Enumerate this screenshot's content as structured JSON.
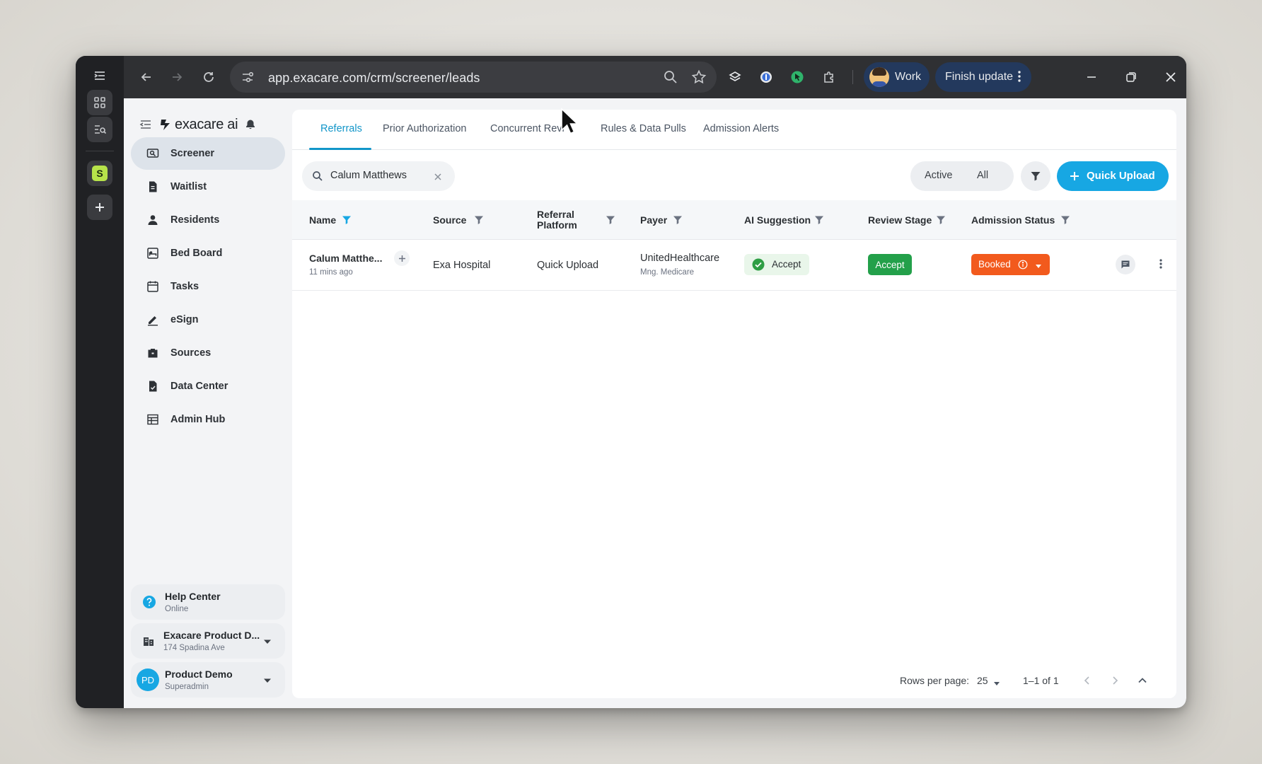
{
  "browser": {
    "url": "app.exacare.com/crm/screener/leads",
    "profile_label": "Work",
    "update_label": "Finish update"
  },
  "sidebar": {
    "brand": "exacare ai",
    "items": [
      {
        "label": "Screener",
        "icon": "screener-icon",
        "active": true
      },
      {
        "label": "Waitlist",
        "icon": "waitlist-icon"
      },
      {
        "label": "Residents",
        "icon": "person-icon"
      },
      {
        "label": "Bed Board",
        "icon": "bed-board-icon"
      },
      {
        "label": "Tasks",
        "icon": "calendar-icon"
      },
      {
        "label": "eSign",
        "icon": "pen-icon"
      },
      {
        "label": "Sources",
        "icon": "briefcase-icon"
      },
      {
        "label": "Data Center",
        "icon": "document-icon"
      },
      {
        "label": "Admin Hub",
        "icon": "table-icon"
      }
    ],
    "help": {
      "title": "Help Center",
      "status": "Online"
    },
    "facility": {
      "name": "Exacare Product D...",
      "address": "174 Spadina Ave"
    },
    "user": {
      "initials": "PD",
      "name": "Product Demo",
      "role": "Superadmin"
    }
  },
  "tabs": [
    "Referrals",
    "Prior Authorization",
    "Concurrent Revi",
    "Rules & Data Pulls",
    "Admission Alerts"
  ],
  "search": {
    "value": "Calum Matthews"
  },
  "toggle": {
    "active": "Active",
    "all": "All"
  },
  "quick_upload": "Quick Upload",
  "table": {
    "headers": {
      "name": "Name",
      "source": "Source",
      "referral_platform_1": "Referral",
      "referral_platform_2": "Platform",
      "payer": "Payer",
      "ai_suggestion": "AI Suggestion",
      "review_stage": "Review Stage",
      "admission_status": "Admission Status"
    },
    "rows": [
      {
        "name": "Calum Matthe...",
        "time": "11 mins ago",
        "source": "Exa Hospital",
        "platform": "Quick Upload",
        "payer": "UnitedHealthcare",
        "payer_sub": "Mng. Medicare",
        "ai_suggestion": "Accept",
        "review_stage": "Accept",
        "admission_status": "Booked"
      }
    ]
  },
  "footer": {
    "rows_label": "Rows per page:",
    "rows_value": "25",
    "range": "1–1 of 1"
  },
  "colors": {
    "accent": "#17a7e3",
    "tab_active": "#1296c9",
    "accept_green": "#23a04a",
    "booked_orange": "#f25a1d"
  }
}
